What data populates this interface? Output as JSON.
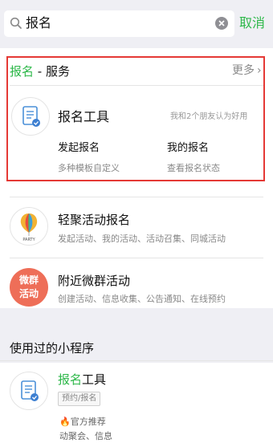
{
  "search": {
    "query": "报名",
    "cancel_label": "取消"
  },
  "services": {
    "title_highlight": "报名",
    "title_rest": " - 服务",
    "more_label": "更多",
    "featured": {
      "title": "报名工具",
      "friends_note": "我和2个朋友认为好用",
      "actions": [
        {
          "title": "发起报名",
          "desc": "多种模板自定义"
        },
        {
          "title": "我的报名",
          "desc": "查看报名状态"
        }
      ]
    },
    "items": [
      {
        "title": "轻聚活动报名",
        "desc": "发起活动、我的活动、活动召集、同城活动",
        "icon_label": "PARTY"
      },
      {
        "title": "附近微群活动",
        "desc": "创建活动、信息收集、公告通知、在线预约",
        "icon_label_1": "微群",
        "icon_label_2": "活动"
      }
    ]
  },
  "used_programs": {
    "section_title": "使用过的小程序",
    "item": {
      "title_highlight": "报名",
      "title_rest": "工具",
      "tag": "预约/报名",
      "promo_line1": "官方推荐",
      "promo_line2": "动聚会、信息"
    }
  },
  "colors": {
    "accent_green": "#2eb84a",
    "highlight_red": "#e53935"
  },
  "icons": [
    "search-icon",
    "clear-icon",
    "chevron-right-icon",
    "form-tool-icon",
    "balloon-icon",
    "weiqun-badge-icon",
    "fire-icon"
  ]
}
